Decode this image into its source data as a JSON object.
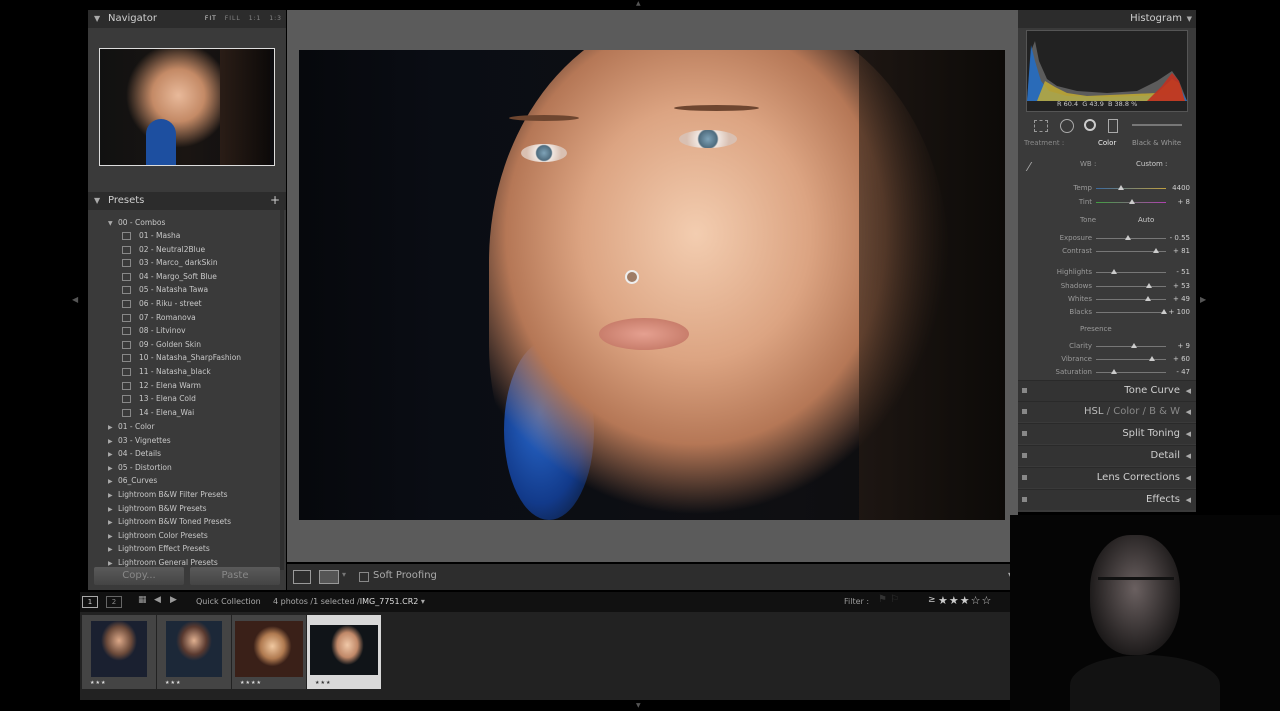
{
  "navigator": {
    "title": "Navigator",
    "options": [
      "FIT",
      "FILL",
      "1:1",
      "1:3"
    ]
  },
  "presets": {
    "title": "Presets",
    "add": "+",
    "folder_open": "00 - Combos",
    "items": [
      "01 - Masha",
      "02 - Neutral2Blue",
      "03 - Marco_ darkSkin",
      "04 - Margo_Soft Blue",
      "05 - Natasha Tawa",
      "06 - Riku - street",
      "07 - Romanova",
      "08 - Litvinov",
      "09 - Golden Skin",
      "10 - Natasha_SharpFashion",
      "11 - Natasha_black",
      "12 - Elena Warm",
      "13 - Elena Cold",
      "14 - Elena_Wai"
    ],
    "folders": [
      "01 - Color",
      "03 - Vignettes",
      "04 - Details",
      "05 - Distortion",
      "06_Curves",
      "Lightroom B&W Filter Presets",
      "Lightroom B&W Presets",
      "Lightroom B&W Toned Presets",
      "Lightroom Color Presets",
      "Lightroom Effect Presets",
      "Lightroom General Presets"
    ]
  },
  "left_buttons": {
    "copy": "Copy...",
    "paste": "Paste"
  },
  "toolbar": {
    "soft_proofing": "Soft Proofing"
  },
  "histogram": {
    "title": "Histogram",
    "r_label": "R",
    "r": "60.4",
    "g_label": "G",
    "g": "43.9",
    "b_label": "B",
    "b": "38.8",
    "unit": "%"
  },
  "treatment": {
    "label": "Treatment :",
    "color": "Color",
    "bw": "Black & White"
  },
  "wb": {
    "label": "WB :",
    "value": "Custom :"
  },
  "basic": {
    "tone_label": "Tone",
    "auto": "Auto",
    "presence_label": "Presence",
    "sliders": [
      {
        "label": "Temp",
        "value": "4400",
        "pos": 0.35
      },
      {
        "label": "Tint",
        "value": "+ 8",
        "pos": 0.52
      },
      {
        "label": "Exposure",
        "value": "- 0.55",
        "pos": 0.45
      },
      {
        "label": "Contrast",
        "value": "+ 81",
        "pos": 0.85
      },
      {
        "label": "Highlights",
        "value": "- 51",
        "pos": 0.25
      },
      {
        "label": "Shadows",
        "value": "+ 53",
        "pos": 0.76
      },
      {
        "label": "Whites",
        "value": "+ 49",
        "pos": 0.74
      },
      {
        "label": "Blacks",
        "value": "+ 100",
        "pos": 0.97
      },
      {
        "label": "Clarity",
        "value": "+ 9",
        "pos": 0.54
      },
      {
        "label": "Vibrance",
        "value": "+ 60",
        "pos": 0.8
      },
      {
        "label": "Saturation",
        "value": "- 47",
        "pos": 0.26
      }
    ]
  },
  "sections": [
    "Tone Curve",
    "Split Toning",
    "Detail",
    "Lens Corrections",
    "Effects"
  ],
  "hsl": {
    "hsl": "HSL",
    "sep1": "/",
    "color": "Color",
    "sep2": "/",
    "bw": "B & W"
  },
  "filmstrip": {
    "page1": "1",
    "page2": "2",
    "source": "Quick Collection",
    "count": "4 photos /1 selected /",
    "filename": "IMG_7751.CR2",
    "filter_label": "Filter :",
    "rating_op": "≥",
    "stars": "★★★☆☆",
    "thumbs": [
      {
        "stars": "★★★"
      },
      {
        "stars": "★★★"
      },
      {
        "stars": "★★★★"
      },
      {
        "stars": "★★★"
      }
    ]
  }
}
